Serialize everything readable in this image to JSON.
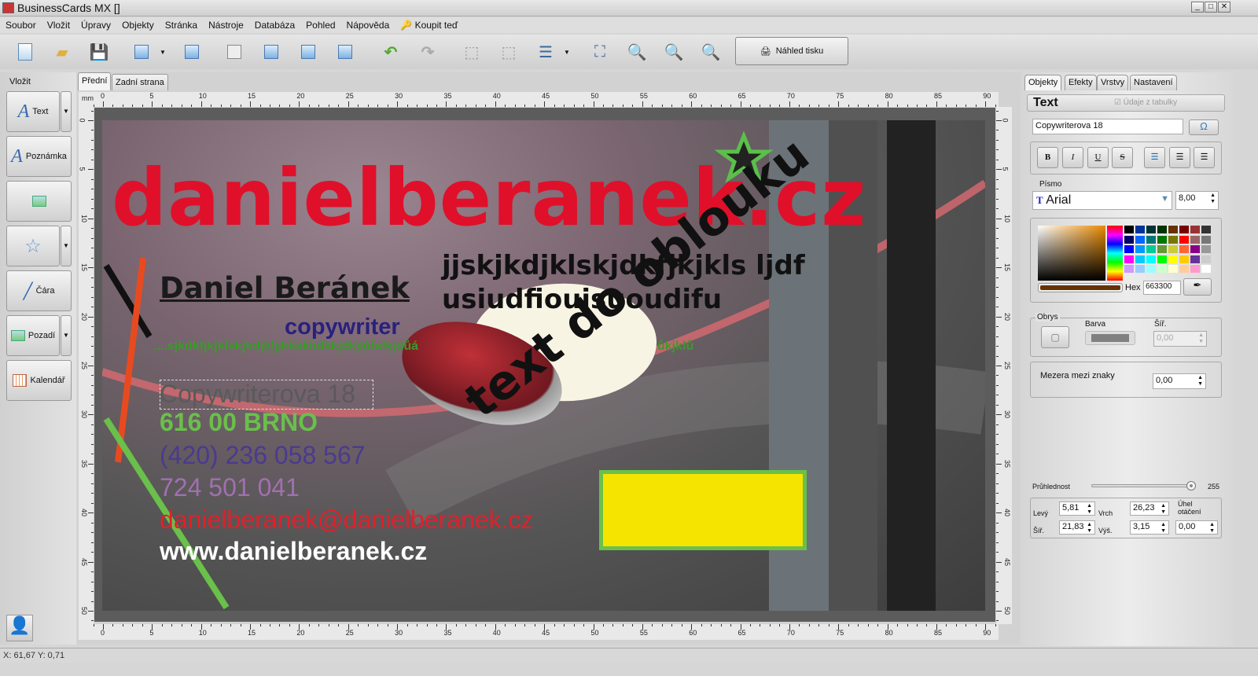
{
  "window": {
    "title": "BusinessCards MX []",
    "min": "_",
    "max": "□",
    "close": "✕"
  },
  "menu": [
    "Soubor",
    "Vložit",
    "Úpravy",
    "Objekty",
    "Stránka",
    "Nástroje",
    "Databáza",
    "Pohled",
    "Nápověda",
    "Koupit teď"
  ],
  "toolbar": {
    "preview_label": "Náhled tisku"
  },
  "left_panel": {
    "title": "Vložit",
    "items": [
      "Text",
      "Poznámka",
      "",
      "",
      "Čára",
      "Pozadí",
      "Kalendář"
    ]
  },
  "page_tabs": [
    "Přední",
    "Zadní strana"
  ],
  "ruler": {
    "unit": "mm",
    "h_labels": [
      "0",
      "5",
      "10",
      "15",
      "20",
      "25",
      "30",
      "35",
      "40",
      "45",
      "50",
      "55",
      "60",
      "65",
      "70",
      "75",
      "80",
      "85",
      "90"
    ],
    "v_labels": [
      "0",
      "5",
      "10",
      "15",
      "20",
      "25",
      "30",
      "35",
      "40",
      "45",
      "50"
    ]
  },
  "card": {
    "domain": "danielberanek.cz",
    "name": "Daniel Beránek",
    "role": "copywriter",
    "filler": "....sjkdkfjkjklskjkdjkljjklisklidkkjdkjlůfslkjdůá",
    "filler2": "ůkjklů",
    "headline1": "jjskjkdjklskjdkfjkjkls ljdf",
    "headline2": "usiudfiouisuoudifu",
    "street": "Copywriterova 18",
    "city": "616 00  BRNO",
    "phone1": "(420) 236 058 567",
    "phone2": "724 501 041",
    "email": "danielberanek@danielberanek.cz",
    "web": "www.danielberanek.cz",
    "arc_text": "text do oblouku"
  },
  "right_panel": {
    "tabs": [
      "Objekty",
      "Efekty",
      "Vrstvy",
      "Nastavení"
    ],
    "object_type": "Text",
    "from_table_label": "Údaje z tabulky",
    "text_value": "Copywriterova 18",
    "font_label": "Písmo",
    "font": "Arial",
    "font_size": "8,00",
    "hex_label": "Hex",
    "hex": "663300",
    "accent": "#663300",
    "outline_label": "Obrys",
    "outline_color_label": "Barva",
    "outline_width_label": "Šíř.",
    "outline_width": "0,00",
    "spacing_label": "Mezera mezi znaky",
    "spacing": "0,00",
    "opacity_label": "Průhlednost",
    "opacity": "255",
    "left_label": "Levý",
    "left": "5,81",
    "top_label": "Vrch",
    "top": "26,23",
    "width_label": "Šíř.",
    "width": "21,83",
    "height_label": "Výš.",
    "height": "3,15",
    "rotation_label": "Úhel otáčení",
    "rotation": "0,00"
  },
  "status": {
    "coords": "X: 61,67 Y: 0,71"
  }
}
